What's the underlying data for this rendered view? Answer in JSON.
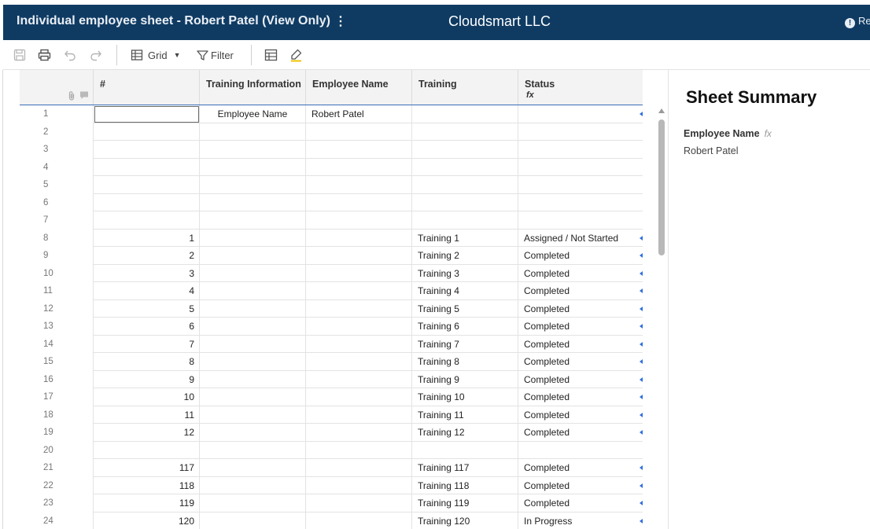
{
  "header": {
    "sheet_title": "Individual employee sheet - Robert Patel (View Only)",
    "kebab": "⋮",
    "company": "Cloudsmart LLC",
    "request_label": "Re",
    "colors": {
      "bar": "#0f3b63",
      "text": "#ffffff"
    }
  },
  "toolbar": {
    "save_icon": "save-icon",
    "print_icon": "print-icon",
    "undo_icon": "undo-icon",
    "redo_icon": "redo-icon",
    "view_label": "Grid",
    "filter_label": "Filter",
    "grid_settings_icon": "table-icon",
    "highlight_icon": "highlighter-icon"
  },
  "grid": {
    "columns": [
      {
        "label": "#",
        "fx": false
      },
      {
        "label": "Training Information",
        "fx": false
      },
      {
        "label": "Employee Name",
        "fx": false
      },
      {
        "label": "Training",
        "fx": false
      },
      {
        "label": "Status",
        "fx": true
      }
    ],
    "fx_symbol": "fx",
    "rows": [
      {
        "n": "1",
        "num": "",
        "info": "Employee Name",
        "emp": "Robert Patel",
        "training": "",
        "status": "",
        "marker": true
      },
      {
        "n": "2",
        "num": "",
        "info": "",
        "emp": "",
        "training": "",
        "status": "",
        "marker": false
      },
      {
        "n": "3",
        "num": "",
        "info": "",
        "emp": "",
        "training": "",
        "status": "",
        "marker": false
      },
      {
        "n": "4",
        "num": "",
        "info": "",
        "emp": "",
        "training": "",
        "status": "",
        "marker": false
      },
      {
        "n": "5",
        "num": "",
        "info": "",
        "emp": "",
        "training": "",
        "status": "",
        "marker": false
      },
      {
        "n": "6",
        "num": "",
        "info": "",
        "emp": "",
        "training": "",
        "status": "",
        "marker": false
      },
      {
        "n": "7",
        "num": "",
        "info": "",
        "emp": "",
        "training": "",
        "status": "",
        "marker": false
      },
      {
        "n": "8",
        "num": "1",
        "info": "",
        "emp": "",
        "training": "Training 1",
        "status": "Assigned / Not Started",
        "marker": true
      },
      {
        "n": "9",
        "num": "2",
        "info": "",
        "emp": "",
        "training": "Training 2",
        "status": "Completed",
        "marker": true
      },
      {
        "n": "10",
        "num": "3",
        "info": "",
        "emp": "",
        "training": "Training 3",
        "status": "Completed",
        "marker": true
      },
      {
        "n": "11",
        "num": "4",
        "info": "",
        "emp": "",
        "training": "Training 4",
        "status": "Completed",
        "marker": true
      },
      {
        "n": "12",
        "num": "5",
        "info": "",
        "emp": "",
        "training": "Training 5",
        "status": "Completed",
        "marker": true
      },
      {
        "n": "13",
        "num": "6",
        "info": "",
        "emp": "",
        "training": "Training 6",
        "status": "Completed",
        "marker": true
      },
      {
        "n": "14",
        "num": "7",
        "info": "",
        "emp": "",
        "training": "Training 7",
        "status": "Completed",
        "marker": true
      },
      {
        "n": "15",
        "num": "8",
        "info": "",
        "emp": "",
        "training": "Training 8",
        "status": "Completed",
        "marker": true
      },
      {
        "n": "16",
        "num": "9",
        "info": "",
        "emp": "",
        "training": "Training 9",
        "status": "Completed",
        "marker": true
      },
      {
        "n": "17",
        "num": "10",
        "info": "",
        "emp": "",
        "training": "Training 10",
        "status": "Completed",
        "marker": true
      },
      {
        "n": "18",
        "num": "11",
        "info": "",
        "emp": "",
        "training": "Training 11",
        "status": "Completed",
        "marker": true
      },
      {
        "n": "19",
        "num": "12",
        "info": "",
        "emp": "",
        "training": "Training 12",
        "status": "Completed",
        "marker": true
      },
      {
        "n": "20",
        "num": "",
        "info": "",
        "emp": "",
        "training": "",
        "status": "",
        "marker": false
      },
      {
        "n": "21",
        "num": "117",
        "info": "",
        "emp": "",
        "training": "Training 117",
        "status": "Completed",
        "marker": true
      },
      {
        "n": "22",
        "num": "118",
        "info": "",
        "emp": "",
        "training": "Training 118",
        "status": "Completed",
        "marker": true
      },
      {
        "n": "23",
        "num": "119",
        "info": "",
        "emp": "",
        "training": "Training 119",
        "status": "Completed",
        "marker": true
      },
      {
        "n": "24",
        "num": "120",
        "info": "",
        "emp": "",
        "training": "Training 120",
        "status": "In Progress",
        "marker": true
      }
    ]
  },
  "summary": {
    "title": "Sheet Summary",
    "field_label": "Employee Name",
    "field_fx": "fx",
    "field_value": "Robert Patel"
  }
}
